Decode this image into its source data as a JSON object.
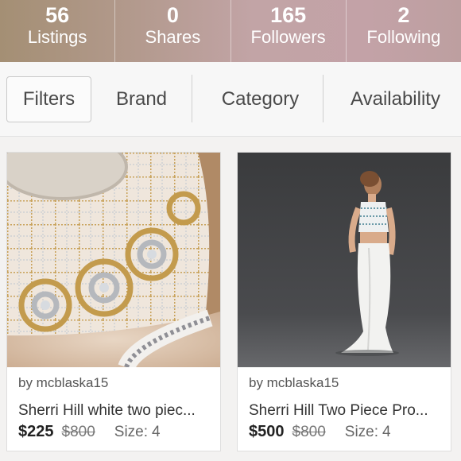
{
  "stats": [
    {
      "number": "56",
      "label": "Listings"
    },
    {
      "number": "0",
      "label": "Shares"
    },
    {
      "number": "165",
      "label": "Followers"
    },
    {
      "number": "2",
      "label": "Following"
    }
  ],
  "filters": {
    "filters_label": "Filters",
    "brand_label": "Brand",
    "category_label": "Category",
    "availability_label": "Availability"
  },
  "listings": [
    {
      "seller": "by mcblaska15",
      "title": "Sherri Hill white two piec...",
      "price": "$225",
      "original_price": "$800",
      "size_label": "Size:",
      "size_value": "4",
      "image": "beaded-crop-top-closeup"
    },
    {
      "seller": "by mcblaska15",
      "title": "Sherri Hill Two Piece Pro...",
      "price": "$500",
      "original_price": "$800",
      "size_label": "Size:",
      "size_value": "4",
      "image": "model-in-white-two-piece-gown"
    }
  ],
  "colors": {
    "header_gradient_start": "#a48f74",
    "header_gradient_end": "#bd9fa0",
    "background": "#f3f2f1"
  }
}
